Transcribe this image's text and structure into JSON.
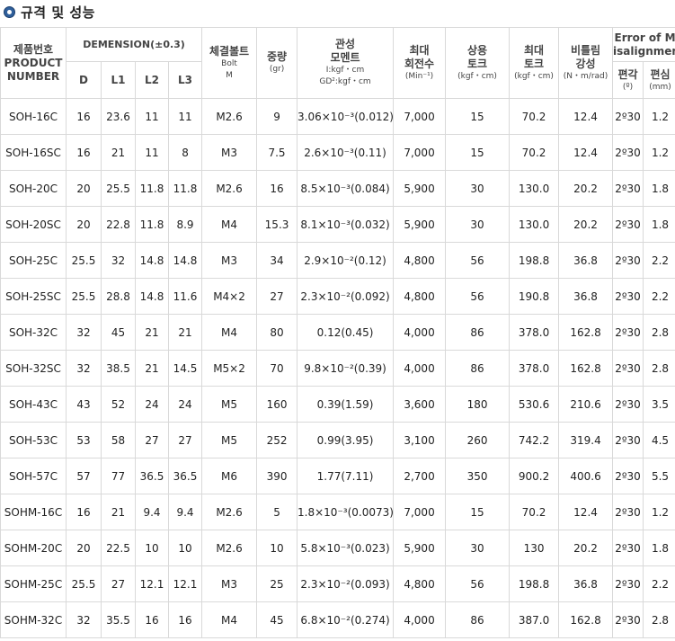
{
  "title": "규격 및 성능",
  "headers": {
    "product_ko": "제품번호",
    "product_en1": "PRODUCT",
    "product_en2": "NUMBER",
    "dimension": "DEMENSION(±0.3)",
    "d": "D",
    "l1": "L1",
    "l2": "L2",
    "l3": "L3",
    "bolt_ko": "체결볼트",
    "bolt_en1": "Bolt",
    "bolt_en2": "M",
    "weight_ko": "중량",
    "weight_unit": "(gr)",
    "inertia_ko1": "관성",
    "inertia_ko2": "모멘트",
    "inertia_unit1": "I:kgf・cm",
    "inertia_unit2": "GD²:kgf・cm",
    "maxrev_ko1": "최대",
    "maxrev_ko2": "회전수",
    "maxrev_unit": "(Min⁻¹)",
    "ratedtorque_ko1": "상용",
    "ratedtorque_ko2": "토크",
    "ratedtorque_unit": "(kgf・cm)",
    "maxtorque_ko1": "최대",
    "maxtorque_ko2": "토크",
    "maxtorque_unit": "(kgf・cm)",
    "torsion_ko1": "비틀림",
    "torsion_ko2": "강성",
    "torsion_unit": "(N・m/rad)",
    "misalign1": "Error of M",
    "misalign2": "isalignment",
    "angle_ko": "편각",
    "angle_unit": "(º)",
    "offset_ko": "편심",
    "offset_unit": "(mm)"
  },
  "rows": [
    [
      "SOH-16C",
      "16",
      "23.6",
      "11",
      "11",
      "M2.6",
      "9",
      "3.06×10⁻³(0.012)",
      "7,000",
      "15",
      "70.2",
      "12.4",
      "2º30",
      "1.2"
    ],
    [
      "SOH-16SC",
      "16",
      "21",
      "11",
      "8",
      "M3",
      "7.5",
      "2.6×10⁻³(0.11)",
      "7,000",
      "15",
      "70.2",
      "12.4",
      "2º30",
      "1.2"
    ],
    [
      "SOH-20C",
      "20",
      "25.5",
      "11.8",
      "11.8",
      "M2.6",
      "16",
      "8.5×10⁻³(0.084)",
      "5,900",
      "30",
      "130.0",
      "20.2",
      "2º30",
      "1.8"
    ],
    [
      "SOH-20SC",
      "20",
      "22.8",
      "11.8",
      "8.9",
      "M4",
      "15.3",
      "8.1×10⁻³(0.032)",
      "5,900",
      "30",
      "130.0",
      "20.2",
      "2º30",
      "1.8"
    ],
    [
      "SOH-25C",
      "25.5",
      "32",
      "14.8",
      "14.8",
      "M3",
      "34",
      "2.9×10⁻²(0.12)",
      "4,800",
      "56",
      "198.8",
      "36.8",
      "2º30",
      "2.2"
    ],
    [
      "SOH-25SC",
      "25.5",
      "28.8",
      "14.8",
      "11.6",
      "M4×2",
      "27",
      "2.3×10⁻²(0.092)",
      "4,800",
      "56",
      "190.8",
      "36.8",
      "2º30",
      "2.2"
    ],
    [
      "SOH-32C",
      "32",
      "45",
      "21",
      "21",
      "M4",
      "80",
      "0.12(0.45)",
      "4,000",
      "86",
      "378.0",
      "162.8",
      "2º30",
      "2.8"
    ],
    [
      "SOH-32SC",
      "32",
      "38.5",
      "21",
      "14.5",
      "M5×2",
      "70",
      "9.8×10⁻²(0.39)",
      "4,000",
      "86",
      "378.0",
      "162.8",
      "2º30",
      "2.8"
    ],
    [
      "SOH-43C",
      "43",
      "52",
      "24",
      "24",
      "M5",
      "160",
      "0.39(1.59)",
      "3,600",
      "180",
      "530.6",
      "210.6",
      "2º30",
      "3.5"
    ],
    [
      "SOH-53C",
      "53",
      "58",
      "27",
      "27",
      "M5",
      "252",
      "0.99(3.95)",
      "3,100",
      "260",
      "742.2",
      "319.4",
      "2º30",
      "4.5"
    ],
    [
      "SOH-57C",
      "57",
      "77",
      "36.5",
      "36.5",
      "M6",
      "390",
      "1.77(7.11)",
      "2,700",
      "350",
      "900.2",
      "400.6",
      "2º30",
      "5.5"
    ],
    [
      "SOHM-16C",
      "16",
      "21",
      "9.4",
      "9.4",
      "M2.6",
      "5",
      "1.8×10⁻³(0.0073)",
      "7,000",
      "15",
      "70.2",
      "12.4",
      "2º30",
      "1.2"
    ],
    [
      "SOHM-20C",
      "20",
      "22.5",
      "10",
      "10",
      "M2.6",
      "10",
      "5.8×10⁻³(0.023)",
      "5,900",
      "30",
      "130",
      "20.2",
      "2º30",
      "1.8"
    ],
    [
      "SOHM-25C",
      "25.5",
      "27",
      "12.1",
      "12.1",
      "M3",
      "25",
      "2.3×10⁻²(0.093)",
      "4,800",
      "56",
      "198.8",
      "36.8",
      "2º30",
      "2.2"
    ],
    [
      "SOHM-32C",
      "32",
      "35.5",
      "16",
      "16",
      "M4",
      "45",
      "6.8×10⁻²(0.274)",
      "4,000",
      "86",
      "387.0",
      "162.8",
      "2º30",
      "2.8"
    ]
  ],
  "colors": {
    "bullet": "#2f5f9b",
    "border": "#d9d9d9"
  },
  "icons": {
    "title_bullet": "circle-bullet-icon"
  }
}
